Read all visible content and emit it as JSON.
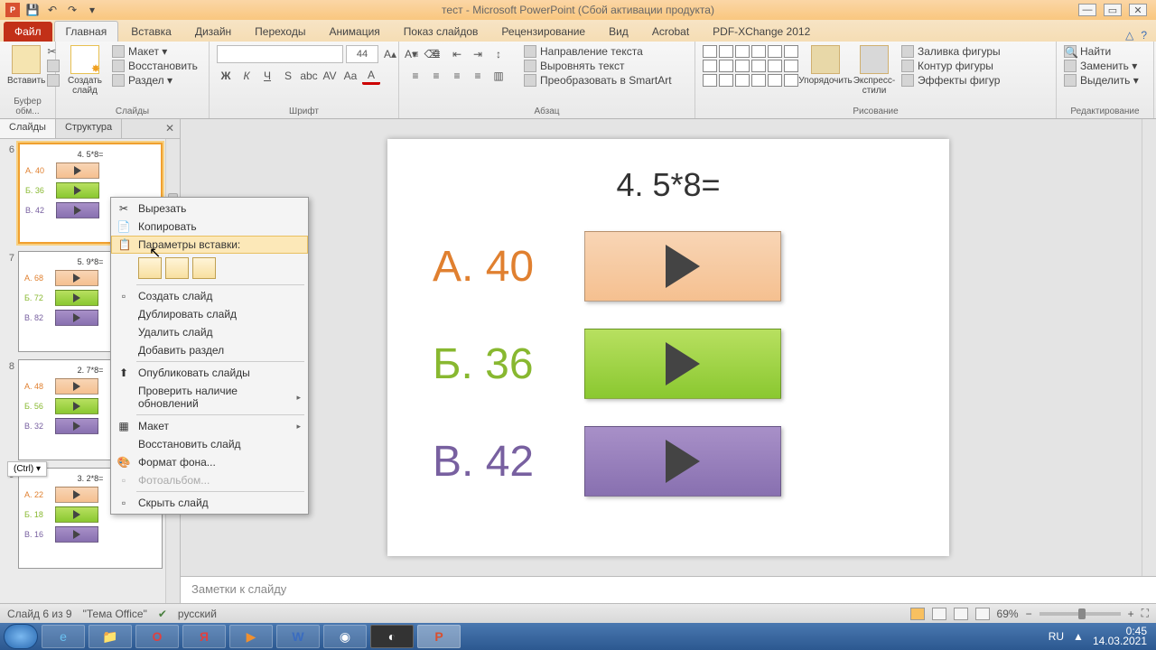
{
  "title": "тест - Microsoft PowerPoint (Сбой активации продукта)",
  "qat": {
    "save": "💾",
    "undo": "↶",
    "redo": "↷"
  },
  "window_buttons": {
    "min": "—",
    "max": "▭",
    "close": "✕"
  },
  "tabs": {
    "file": "Файл",
    "items": [
      "Главная",
      "Вставка",
      "Дизайн",
      "Переходы",
      "Анимация",
      "Показ слайдов",
      "Рецензирование",
      "Вид",
      "Acrobat",
      "PDF-XChange 2012"
    ],
    "active": 0
  },
  "ribbon": {
    "clipboard": {
      "paste": "Вставить",
      "label": "Буфер обм..."
    },
    "slides": {
      "new_slide": "Создать\nслайд",
      "layout": "Макет ▾",
      "reset": "Восстановить",
      "section": "Раздел ▾",
      "label": "Слайды"
    },
    "font": {
      "size": "44",
      "label": "Шрифт"
    },
    "paragraph": {
      "text_dir": "Направление текста",
      "align_text": "Выровнять текст",
      "smartart": "Преобразовать в SmartArt",
      "label": "Абзац"
    },
    "drawing": {
      "arrange": "Упорядочить",
      "quick_styles": "Экспресс-стили",
      "fill": "Заливка фигуры",
      "outline": "Контур фигуры",
      "effects": "Эффекты фигур",
      "label": "Рисование"
    },
    "editing": {
      "find": "Найти",
      "replace": "Заменить ▾",
      "select": "Выделить ▾",
      "label": "Редактирование"
    }
  },
  "panel": {
    "tabs": {
      "slides": "Слайды",
      "outline": "Структура"
    },
    "ctrl_hint": "(Ctrl) ▾"
  },
  "thumbnails": [
    {
      "n": "6",
      "title": "4. 5*8=",
      "answers": [
        [
          "А. 40",
          "c-orange",
          "ta"
        ],
        [
          "Б. 36",
          "c-green",
          "tb"
        ],
        [
          "В. 42",
          "c-purple",
          "tc"
        ]
      ],
      "selected": true
    },
    {
      "n": "7",
      "title": "5. 9*8=",
      "answers": [
        [
          "А. 68",
          "c-orange",
          "ta"
        ],
        [
          "Б. 72",
          "c-green",
          "tb"
        ],
        [
          "В. 82",
          "c-purple",
          "tc"
        ]
      ]
    },
    {
      "n": "8",
      "title": "2. 7*8=",
      "answers": [
        [
          "А. 48",
          "c-orange",
          "ta"
        ],
        [
          "Б. 56",
          "c-green",
          "tb"
        ],
        [
          "В. 32",
          "c-purple",
          "tc"
        ]
      ]
    },
    {
      "n": "9",
      "title": "3. 2*8=",
      "answers": [
        [
          "А. 22",
          "c-orange",
          "ta"
        ],
        [
          "Б. 18",
          "c-green",
          "tb"
        ],
        [
          "В. 16",
          "c-purple",
          "tc"
        ]
      ]
    }
  ],
  "slide": {
    "question": "4. 5*8=",
    "answers": [
      {
        "label": "А. 40",
        "cls": "c-orange",
        "txt": "ta"
      },
      {
        "label": "Б. 36",
        "cls": "c-green",
        "txt": "tb"
      },
      {
        "label": "В. 42",
        "cls": "c-purple",
        "txt": "tc"
      }
    ]
  },
  "notes_placeholder": "Заметки к слайду",
  "status": {
    "slide_info": "Слайд 6 из 9",
    "theme": "\"Тема Office\"",
    "lang": "русский",
    "zoom": "69%"
  },
  "context_menu": {
    "cut": "Вырезать",
    "copy": "Копировать",
    "paste_label": "Параметры вставки:",
    "new_slide": "Создать слайд",
    "duplicate": "Дублировать слайд",
    "delete": "Удалить слайд",
    "add_section": "Добавить раздел",
    "publish": "Опубликовать слайды",
    "check_updates": "Проверить наличие обновлений",
    "layout": "Макет",
    "reset": "Восстановить слайд",
    "format_bg": "Формат фона...",
    "photo_album": "Фотоальбом...",
    "hide": "Скрыть слайд"
  },
  "taskbar": {
    "lang": "RU",
    "time": "0:45",
    "date": "14.03.2021"
  }
}
